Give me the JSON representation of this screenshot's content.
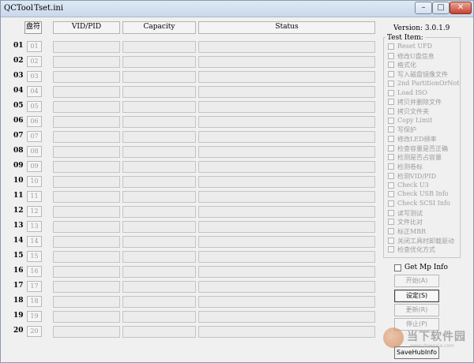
{
  "window": {
    "app_name": "QCTool",
    "file_name": "Tset.ini",
    "minimize": "–",
    "maximize": "□",
    "close": "✕"
  },
  "columns": {
    "disk": "盘符",
    "vidpid": "VID/PID",
    "capacity": "Capacity",
    "status": "Status"
  },
  "rows": [
    {
      "num": "01",
      "disk": "01"
    },
    {
      "num": "02",
      "disk": "02"
    },
    {
      "num": "03",
      "disk": "03"
    },
    {
      "num": "04",
      "disk": "04"
    },
    {
      "num": "05",
      "disk": "05"
    },
    {
      "num": "06",
      "disk": "06"
    },
    {
      "num": "07",
      "disk": "07"
    },
    {
      "num": "08",
      "disk": "08"
    },
    {
      "num": "09",
      "disk": "09"
    },
    {
      "num": "10",
      "disk": "10"
    },
    {
      "num": "11",
      "disk": "11"
    },
    {
      "num": "12",
      "disk": "12"
    },
    {
      "num": "13",
      "disk": "13"
    },
    {
      "num": "14",
      "disk": "14"
    },
    {
      "num": "15",
      "disk": "15"
    },
    {
      "num": "16",
      "disk": "16"
    },
    {
      "num": "17",
      "disk": "17"
    },
    {
      "num": "18",
      "disk": "18"
    },
    {
      "num": "19",
      "disk": "19"
    },
    {
      "num": "20",
      "disk": "20"
    }
  ],
  "version": "Version: 3.0.1.9",
  "test_item_title": "Test Item:",
  "test_items": [
    "Reset UFD",
    "修改U盘信息",
    "格式化",
    "写入磁盘镜像文件",
    "2nd PartitionOrNot",
    "Load ISO",
    "拷贝并删除文件",
    "拷贝文件夹",
    "Copy Limit",
    "写保护",
    "修改LED频率",
    "检查容量是否正确",
    "检测是否占容量",
    "检测卷标",
    "检测VID/PID",
    "Check U3",
    "Check USB Info",
    "Check SCSI Info",
    "读写测试",
    "文件比对",
    "标正MBR",
    "关闭工具时卸载驱动",
    "检查优化方式"
  ],
  "get_mp_info": "Get Mp Info",
  "buttons": {
    "start": "开始(A)",
    "settings": "设定(S)",
    "update": "更新(R)",
    "stop": "停止(P)",
    "save_hub": "SaveHubInfo"
  },
  "watermark": {
    "text": "当下软件园",
    "url": "www.downxia.com"
  }
}
